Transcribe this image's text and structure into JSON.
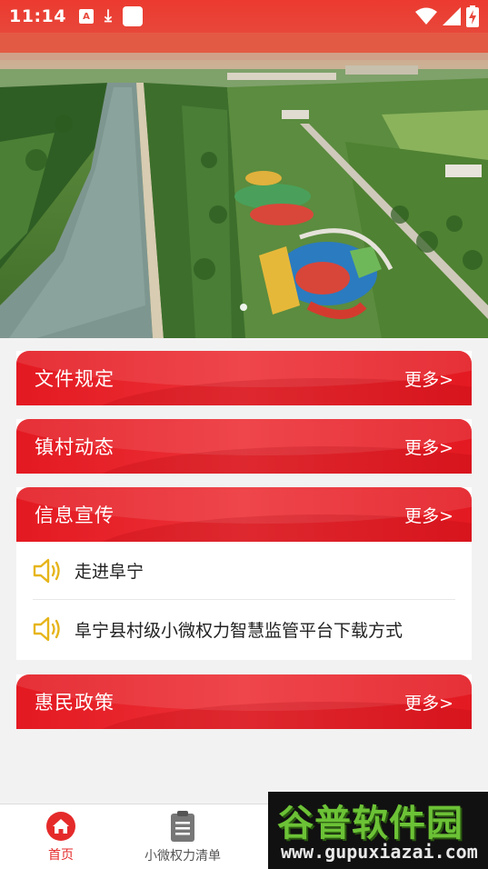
{
  "status_bar": {
    "time": "11:14",
    "left_icons": [
      "a-box-icon",
      "download-icon",
      "square-icon"
    ],
    "right_icons": [
      "wifi-icon",
      "signal-icon",
      "battery-charging-icon"
    ]
  },
  "banner": {
    "image": "aerial-park-river-photo",
    "dots": 1
  },
  "sections": [
    {
      "title": "文件规定",
      "more": "更多>"
    },
    {
      "title": "镇村动态",
      "more": "更多>"
    },
    {
      "title": "信息宣传",
      "more": "更多>"
    },
    {
      "title": "惠民政策",
      "more": "更多>"
    }
  ],
  "info_list": [
    {
      "icon": "speaker-icon",
      "text": "走进阜宁"
    },
    {
      "icon": "speaker-icon",
      "text": "阜宁县村级小微权力智慧监管平台下载方式"
    }
  ],
  "bottom_nav": [
    {
      "label": "首页",
      "icon": "home-icon",
      "active": true
    },
    {
      "label": "小微权力清单",
      "icon": "clipboard-icon",
      "active": false
    }
  ],
  "watermark": {
    "cn": "谷普软件园",
    "url": "www.gupuxiazai.com"
  },
  "colors": {
    "primary_red": "#e41921",
    "status_red": "#ec3a30",
    "speaker_yellow": "#e6b51a",
    "active_nav": "#e52a2a"
  }
}
